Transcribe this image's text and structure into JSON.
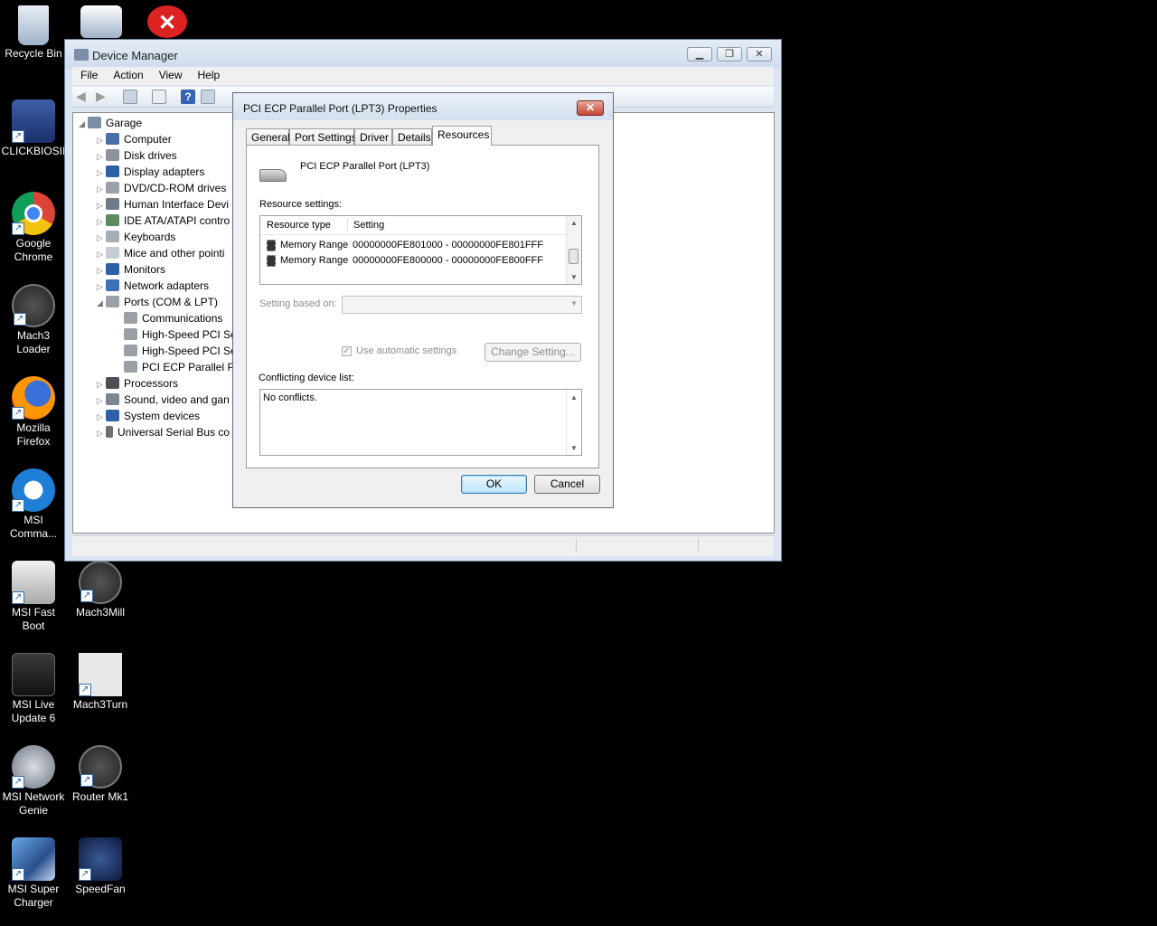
{
  "desktop": {
    "icons": [
      {
        "label": "Recycle Bin",
        "icon": "recycle-bin-icon"
      },
      {
        "label": "CLICKBIOSII",
        "icon": "bios-icon"
      },
      {
        "label": "Google Chrome",
        "icon": "chrome-icon"
      },
      {
        "label": "Mach3 Loader",
        "icon": "mach3-icon"
      },
      {
        "label": "Mozilla Firefox",
        "icon": "firefox-icon"
      },
      {
        "label": "MSI Comma...",
        "icon": "msi-command-icon"
      },
      {
        "label": "MSI Fast Boot",
        "icon": "fast-boot-icon"
      },
      {
        "label": "Mach3Mill",
        "icon": "mach3-icon"
      },
      {
        "label": "MSI Live Update 6",
        "icon": "live-update-icon"
      },
      {
        "label": "Mach3Turn",
        "icon": "lathe-icon"
      },
      {
        "label": "MSI Network Genie",
        "icon": "network-genie-icon"
      },
      {
        "label": "Router Mk1",
        "icon": "mach3-icon"
      },
      {
        "label": "MSI Super Charger",
        "icon": "super-charger-icon"
      },
      {
        "label": "SpeedFan",
        "icon": "speedfan-icon"
      }
    ]
  },
  "device_manager": {
    "title": "Device Manager",
    "menu": [
      "File",
      "Action",
      "View",
      "Help"
    ],
    "tree": {
      "root": "Garage",
      "items": [
        "Computer",
        "Disk drives",
        "Display adapters",
        "DVD/CD-ROM drives",
        "Human Interface Devi",
        "IDE ATA/ATAPI contro",
        "Keyboards",
        "Mice and other pointi",
        "Monitors",
        "Network adapters",
        "Ports (COM & LPT)"
      ],
      "ports_children": [
        "Communications",
        "High-Speed PCI Se",
        "High-Speed PCI Se",
        "PCI ECP Parallel Po"
      ],
      "items_after": [
        "Processors",
        "Sound, video and gan",
        "System devices",
        "Universal Serial Bus co"
      ]
    }
  },
  "dialog": {
    "title": "PCI ECP Parallel Port (LPT3) Properties",
    "close_label": "✕",
    "tabs": [
      "General",
      "Port Settings",
      "Driver",
      "Details",
      "Resources"
    ],
    "active_tab": "Resources",
    "device_name": "PCI ECP Parallel Port (LPT3)",
    "resource_settings_label": "Resource settings:",
    "columns": [
      "Resource type",
      "Setting"
    ],
    "resources": [
      {
        "type": "Memory Range",
        "setting": "00000000FE801000 - 00000000FE801FFF"
      },
      {
        "type": "Memory Range",
        "setting": "00000000FE800000 - 00000000FE800FFF"
      }
    ],
    "setting_based_on_label": "Setting based on:",
    "setting_based_on_value": "",
    "use_automatic_label": "Use automatic settings",
    "use_automatic_checked": true,
    "change_setting_label": "Change Setting...",
    "conflicting_label": "Conflicting device list:",
    "conflicts_text": "No conflicts.",
    "ok_label": "OK",
    "cancel_label": "Cancel"
  }
}
